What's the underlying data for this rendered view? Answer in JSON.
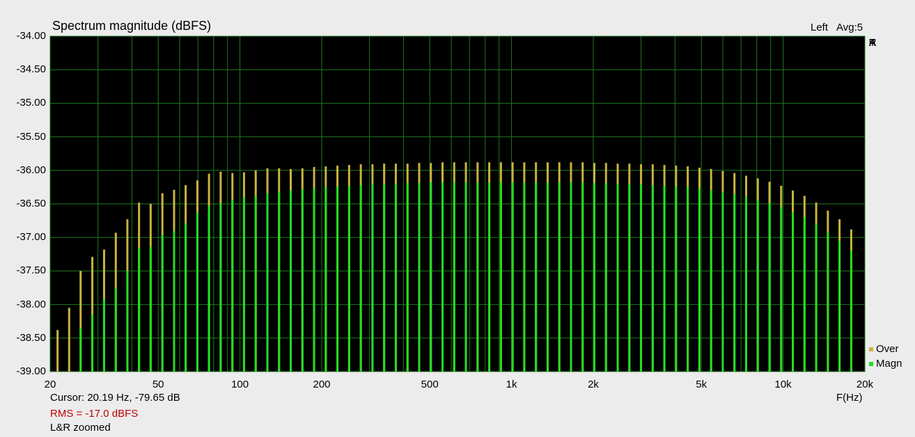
{
  "header": {
    "title": "Spectrum magnitude (dBFS)",
    "channel": "Left",
    "avg": "Avg:5",
    "brand_letters": [
      "A",
      "R",
      "T",
      "A"
    ]
  },
  "footer": {
    "cursor": "Cursor: 20.19 Hz, -79.65 dB",
    "rms": "RMS =  -17.0 dBFS",
    "mode": "L&R zoomed",
    "xunit": "F(Hz)"
  },
  "colors": {
    "background": "#000000",
    "grid": "#1f7a1f",
    "over": "#c8b440",
    "magn": "#22dd22",
    "rms_text": "#c00000"
  },
  "chart_data": {
    "type": "bar",
    "title": "Spectrum magnitude (dBFS)",
    "xlabel": "F(Hz)",
    "ylabel": "",
    "x_scale": "log",
    "xlim": [
      20,
      20000
    ],
    "ylim": [
      -39.0,
      -34.0
    ],
    "grid": true,
    "legend_position": "bottom-right",
    "y_ticks": [
      "-34.00",
      "-34.50",
      "-35.00",
      "-35.50",
      "-36.00",
      "-36.50",
      "-37.00",
      "-37.50",
      "-38.00",
      "-38.50",
      "-39.00"
    ],
    "x_ticks": [
      {
        "value": 20,
        "label": "20"
      },
      {
        "value": 50,
        "label": "50"
      },
      {
        "value": 100,
        "label": "100"
      },
      {
        "value": 200,
        "label": "200"
      },
      {
        "value": 500,
        "label": "500"
      },
      {
        "value": 1000,
        "label": "1k"
      },
      {
        "value": 2000,
        "label": "2k"
      },
      {
        "value": 5000,
        "label": "5k"
      },
      {
        "value": 10000,
        "label": "10k"
      },
      {
        "value": 20000,
        "label": "20k"
      }
    ],
    "x": [
      21.3,
      23.5,
      25.9,
      28.6,
      31.6,
      34.9,
      38.5,
      42.5,
      46.9,
      51.8,
      57.2,
      63.1,
      69.7,
      76.9,
      84.9,
      93.8,
      103.5,
      114.3,
      126.2,
      139.3,
      153.8,
      169.8,
      187.5,
      207.0,
      228.5,
      252.3,
      278.6,
      307.6,
      339.6,
      374.9,
      414.0,
      457.0,
      504.6,
      557.1,
      615.1,
      679.1,
      749.8,
      827.8,
      913.9,
      1009.1,
      1114.1,
      1230.0,
      1358.0,
      1499.4,
      1655.4,
      1827.7,
      2017.9,
      2227.9,
      2459.7,
      2715.7,
      2998.3,
      3310.3,
      3654.8,
      4035.1,
      4455.0,
      4918.6,
      5430.5,
      5995.6,
      6619.5,
      7308.4,
      8068.9,
      8908.6,
      9835.7,
      10859.2,
      11989.3,
      13236.9,
      14614.4,
      16135.3,
      17814.4
    ],
    "series": [
      {
        "name": "Over",
        "values": [
          -38.38,
          -38.05,
          -37.5,
          -37.29,
          -37.18,
          -36.93,
          -36.73,
          -36.48,
          -36.5,
          -36.34,
          -36.29,
          -36.22,
          -36.15,
          -36.05,
          -36.02,
          -36.04,
          -36.03,
          -36.0,
          -35.97,
          -35.97,
          -35.98,
          -35.97,
          -35.95,
          -35.94,
          -35.93,
          -35.92,
          -35.91,
          -35.91,
          -35.9,
          -35.9,
          -35.9,
          -35.89,
          -35.89,
          -35.88,
          -35.88,
          -35.88,
          -35.88,
          -35.88,
          -35.88,
          -35.88,
          -35.88,
          -35.88,
          -35.88,
          -35.88,
          -35.88,
          -35.88,
          -35.89,
          -35.89,
          -35.9,
          -35.9,
          -35.91,
          -35.91,
          -35.92,
          -35.93,
          -35.94,
          -35.96,
          -35.98,
          -36.01,
          -36.04,
          -36.08,
          -36.12,
          -36.17,
          -36.23,
          -36.3,
          -36.38,
          -36.48,
          -36.6,
          -36.73,
          -36.88
        ]
      },
      {
        "name": "Magn",
        "values": [
          -39.0,
          -39.0,
          -38.35,
          -38.15,
          -37.92,
          -37.75,
          -37.5,
          -37.16,
          -37.14,
          -36.96,
          -36.91,
          -36.79,
          -36.63,
          -36.53,
          -36.49,
          -36.44,
          -36.4,
          -36.38,
          -36.34,
          -36.32,
          -36.3,
          -36.28,
          -36.27,
          -36.25,
          -36.24,
          -36.23,
          -36.22,
          -36.21,
          -36.2,
          -36.2,
          -36.19,
          -36.19,
          -36.18,
          -36.18,
          -36.18,
          -36.18,
          -36.18,
          -36.18,
          -36.18,
          -36.18,
          -36.18,
          -36.18,
          -36.18,
          -36.18,
          -36.18,
          -36.18,
          -36.19,
          -36.19,
          -36.2,
          -36.2,
          -36.21,
          -36.22,
          -36.23,
          -36.24,
          -36.25,
          -36.27,
          -36.29,
          -36.32,
          -36.35,
          -36.39,
          -36.44,
          -36.49,
          -36.55,
          -36.62,
          -36.7,
          -36.8,
          -36.92,
          -37.05,
          -37.2
        ]
      }
    ]
  }
}
